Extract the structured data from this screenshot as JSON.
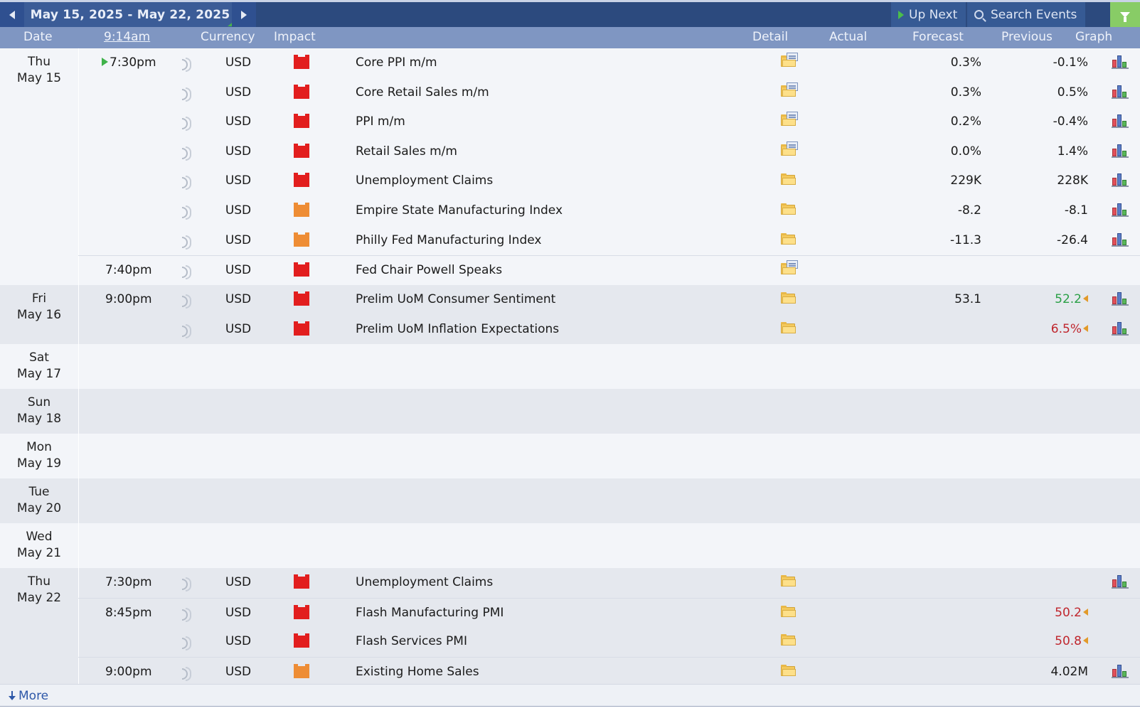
{
  "nav": {
    "range_label": "May 15, 2025 - May 22, 2025",
    "up_next_label": "Up Next",
    "search_label": "Search Events"
  },
  "header": {
    "date": "Date",
    "now_time": "9:14am",
    "currency": "Currency",
    "impact": "Impact",
    "detail": "Detail",
    "actual": "Actual",
    "forecast": "Forecast",
    "previous": "Previous",
    "graph": "Graph"
  },
  "days": [
    {
      "weekday": "Thu",
      "date": "May 15",
      "events": [
        {
          "time": "7:30pm",
          "currency": "USD",
          "impact": "high",
          "event": "Core PPI m/m",
          "detail_doc": true,
          "forecast": "0.3%",
          "previous": "-0.1%",
          "graph": true,
          "up_next": true
        },
        {
          "time": "",
          "currency": "USD",
          "impact": "high",
          "event": "Core Retail Sales m/m",
          "detail_doc": true,
          "forecast": "0.3%",
          "previous": "0.5%",
          "graph": true
        },
        {
          "time": "",
          "currency": "USD",
          "impact": "high",
          "event": "PPI m/m",
          "detail_doc": true,
          "forecast": "0.2%",
          "previous": "-0.4%",
          "graph": true
        },
        {
          "time": "",
          "currency": "USD",
          "impact": "high",
          "event": "Retail Sales m/m",
          "detail_doc": true,
          "forecast": "0.0%",
          "previous": "1.4%",
          "graph": true
        },
        {
          "time": "",
          "currency": "USD",
          "impact": "high",
          "event": "Unemployment Claims",
          "detail_doc": false,
          "forecast": "229K",
          "previous": "228K",
          "graph": true
        },
        {
          "time": "",
          "currency": "USD",
          "impact": "medium",
          "event": "Empire State Manufacturing Index",
          "detail_doc": false,
          "forecast": "-8.2",
          "previous": "-8.1",
          "graph": true
        },
        {
          "time": "",
          "currency": "USD",
          "impact": "medium",
          "event": "Philly Fed Manufacturing Index",
          "detail_doc": false,
          "forecast": "-11.3",
          "previous": "-26.4",
          "graph": true
        },
        {
          "time": "7:40pm",
          "currency": "USD",
          "impact": "high",
          "event": "Fed Chair Powell Speaks",
          "detail_doc": true,
          "forecast": "",
          "previous": "",
          "graph": false
        }
      ]
    },
    {
      "weekday": "Fri",
      "date": "May 16",
      "events": [
        {
          "time": "9:00pm",
          "currency": "USD",
          "impact": "high",
          "event": "Prelim UoM Consumer Sentiment",
          "detail_doc": false,
          "forecast": "53.1",
          "previous": "52.2",
          "previous_color": "#2aa046",
          "revised": true,
          "graph": true
        },
        {
          "time": "",
          "currency": "USD",
          "impact": "high",
          "event": "Prelim UoM Inflation Expectations",
          "detail_doc": false,
          "forecast": "",
          "previous": "6.5%",
          "previous_color": "#c0262d",
          "revised": true,
          "graph": true
        }
      ]
    },
    {
      "weekday": "Sat",
      "date": "May 17",
      "events": []
    },
    {
      "weekday": "Sun",
      "date": "May 18",
      "events": []
    },
    {
      "weekday": "Mon",
      "date": "May 19",
      "events": []
    },
    {
      "weekday": "Tue",
      "date": "May 20",
      "events": []
    },
    {
      "weekday": "Wed",
      "date": "May 21",
      "events": []
    },
    {
      "weekday": "Thu",
      "date": "May 22",
      "events": [
        {
          "time": "7:30pm",
          "currency": "USD",
          "impact": "high",
          "event": "Unemployment Claims",
          "detail_doc": false,
          "forecast": "",
          "previous": "",
          "graph": true
        },
        {
          "time": "8:45pm",
          "currency": "USD",
          "impact": "high",
          "event": "Flash Manufacturing PMI",
          "detail_doc": false,
          "forecast": "",
          "previous": "50.2",
          "previous_color": "#c0262d",
          "revised": true,
          "graph": false
        },
        {
          "time": "",
          "currency": "USD",
          "impact": "high",
          "event": "Flash Services PMI",
          "detail_doc": false,
          "forecast": "",
          "previous": "50.8",
          "previous_color": "#c0262d",
          "revised": true,
          "graph": false
        },
        {
          "time": "9:00pm",
          "currency": "USD",
          "impact": "medium",
          "event": "Existing Home Sales",
          "detail_doc": false,
          "forecast": "",
          "previous": "4.02M",
          "graph": true
        }
      ]
    }
  ],
  "footer": {
    "more_label": "More"
  },
  "colors": {
    "nav_bg": "#2c4a7e",
    "header_bg": "#7f96c2",
    "impact_high": "#e21e1e",
    "impact_medium": "#ee8d35",
    "filter_bg": "#88cc66"
  }
}
